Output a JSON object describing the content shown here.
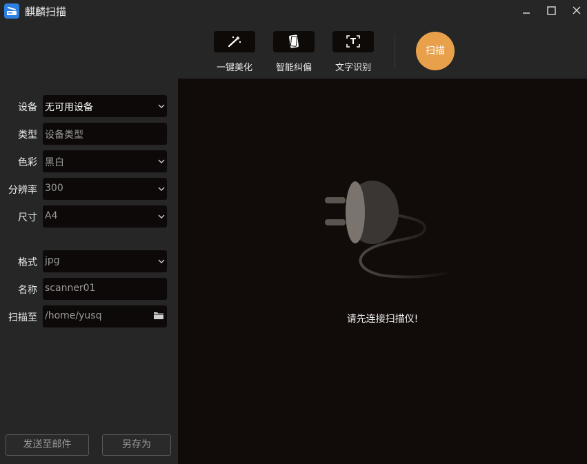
{
  "window": {
    "title": "麒麟扫描"
  },
  "toolbar": {
    "tools": [
      {
        "label": "一键美化",
        "icon": "magic-wand-icon"
      },
      {
        "label": "智能纠偏",
        "icon": "deskew-icon"
      },
      {
        "label": "文字识别",
        "icon": "ocr-text-icon"
      }
    ],
    "scan_label": "扫描"
  },
  "settings": {
    "device": {
      "label": "设备",
      "value": "无可用设备"
    },
    "type": {
      "label": "类型",
      "placeholder": "设备类型"
    },
    "color": {
      "label": "色彩",
      "value": "黑白"
    },
    "resolution": {
      "label": "分辨率",
      "value": "300"
    },
    "size": {
      "label": "尺寸",
      "value": "A4"
    },
    "format": {
      "label": "格式",
      "value": "jpg"
    },
    "name": {
      "label": "名称",
      "value": "scanner01"
    },
    "save_to": {
      "label": "扫描至",
      "value": "/home/yusq"
    }
  },
  "actions": {
    "send_mail": "发送至邮件",
    "save_as": "另存为"
  },
  "main": {
    "message": "请先连接扫描仪!"
  },
  "colors": {
    "accent": "#e8a04a",
    "panel": "#262626",
    "canvas": "#110c09",
    "field": "#0d0908"
  }
}
